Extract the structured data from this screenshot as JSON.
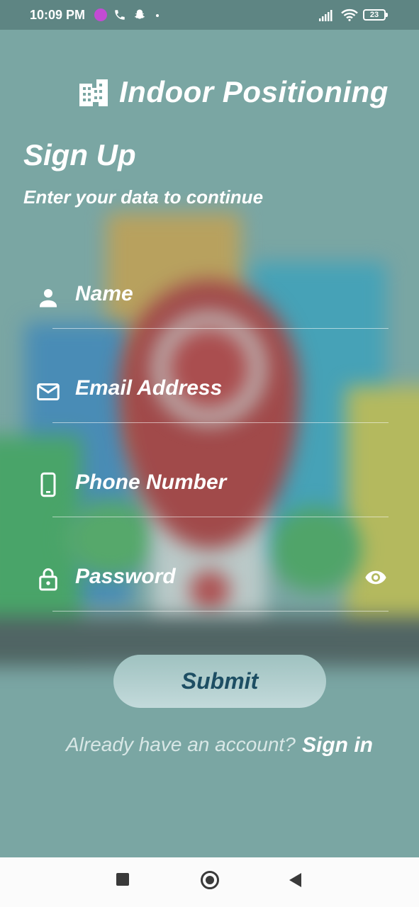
{
  "status_bar": {
    "time": "10:09 PM",
    "battery": "23",
    "icons": [
      "messenger-icon",
      "phone-icon",
      "snapchat-icon",
      "signal-icon",
      "wifi-icon",
      "battery-icon"
    ]
  },
  "app": {
    "title": "Indoor Positioning",
    "logo_icon": "building-icon"
  },
  "form": {
    "heading": "Sign Up",
    "subheading": "Enter your data to continue",
    "fields": [
      {
        "icon": "person-icon",
        "placeholder": "Name"
      },
      {
        "icon": "mail-icon",
        "placeholder": "Email Address"
      },
      {
        "icon": "smartphone-icon",
        "placeholder": "Phone Number"
      },
      {
        "icon": "lock-icon",
        "placeholder": "Password",
        "trailing_icon": "eye-icon"
      }
    ],
    "submit_label": "Submit",
    "already_text": "Already have an account?",
    "signin_label": "Sign in"
  },
  "colors": {
    "background": "#7aa6a4",
    "button_text": "#1d4e63",
    "status_bar": "#5e8583"
  }
}
